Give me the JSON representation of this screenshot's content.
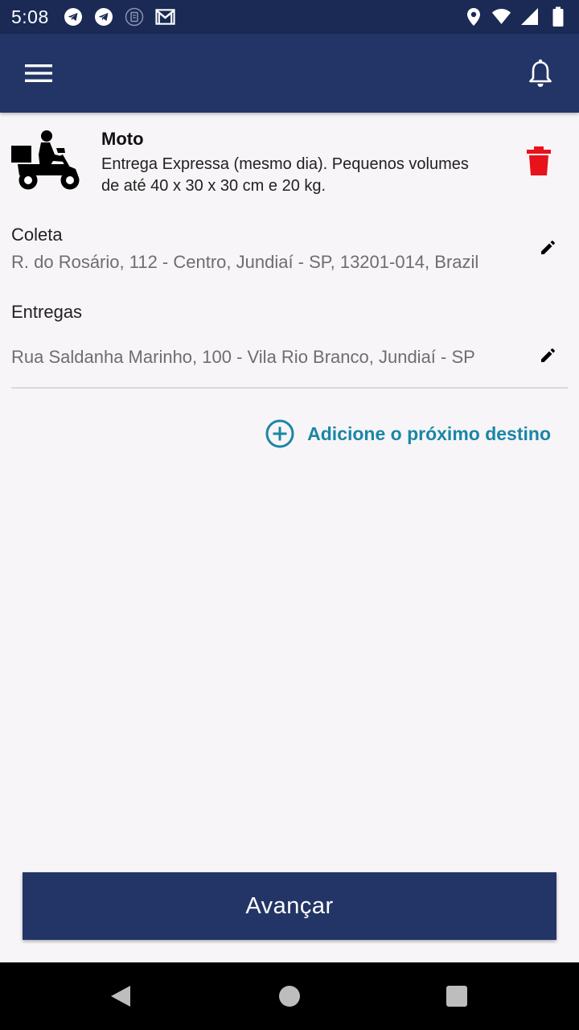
{
  "status_bar": {
    "time": "5:08",
    "left_icons": [
      "telegram-icon",
      "telegram-icon",
      "sim-card-icon",
      "gmail-icon"
    ],
    "right_icons": [
      "location-icon",
      "wifi-icon",
      "signal-icon",
      "battery-icon"
    ]
  },
  "app_bar": {
    "menu_icon": "hamburger-menu-icon",
    "notification_icon": "bell-icon"
  },
  "vehicle": {
    "name": "Moto",
    "description": "Entrega Expressa (mesmo dia). Pequenos volumes de até 40 x 30 x 30 cm e 20 kg.",
    "image_icon": "motorcycle-courier-icon",
    "delete_icon": "trash-icon",
    "delete_color": "#e8121b"
  },
  "pickup": {
    "label": "Coleta",
    "address": "R. do Rosário, 112 - Centro, Jundiaí - SP, 13201-014, Brazil",
    "edit_icon": "pencil-icon"
  },
  "deliveries": {
    "label": "Entregas",
    "items": [
      {
        "address": "Rua Saldanha Marinho, 100 - Vila Rio Branco, Jundiaí - SP",
        "edit_icon": "pencil-icon"
      }
    ]
  },
  "add_destination": {
    "label": "Adicione o próximo destino",
    "icon": "plus-circle-icon",
    "color": "#1a86a6"
  },
  "advance_button": {
    "label": "Avançar"
  },
  "colors": {
    "primary": "#233566",
    "status_bar": "#1a2a55",
    "background": "#f7f5f7"
  },
  "nav_bar": {
    "icons": [
      "back-icon",
      "home-icon",
      "recents-icon"
    ]
  }
}
